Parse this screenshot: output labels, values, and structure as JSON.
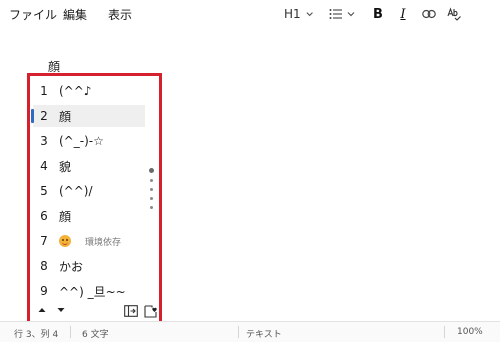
{
  "menu": {
    "file": "ファイル",
    "edit": "編集",
    "view": "表示"
  },
  "toolbar": {
    "heading": "H1",
    "icons": [
      "chevron-down-icon",
      "list-icon",
      "chevron-down-icon",
      "bold-icon",
      "italic-icon",
      "link-icon",
      "spellcheck-icon"
    ],
    "bold": "B",
    "italic": "I"
  },
  "editor": {
    "composing_text": "顔"
  },
  "ime": {
    "candidates": [
      {
        "num": "1",
        "text": "(^^♪"
      },
      {
        "num": "2",
        "text": "顔",
        "selected": true
      },
      {
        "num": "3",
        "text": "(^_-)-☆"
      },
      {
        "num": "4",
        "text": "貌"
      },
      {
        "num": "5",
        "text": "(^^)/"
      },
      {
        "num": "6",
        "text": "顔"
      },
      {
        "num": "7",
        "text": "",
        "emoji": "smiling-face-emoji",
        "note": "環境依存"
      },
      {
        "num": "8",
        "text": "かお"
      },
      {
        "num": "9",
        "text": "^^) _旦~~"
      }
    ],
    "footer_icons": [
      "arrow-up-icon",
      "arrow-down-icon",
      "expand-panel-icon",
      "favorite-icon"
    ]
  },
  "status": {
    "position": "行 3、列 4",
    "chars": "6 文字",
    "format": "テキスト",
    "zoom": "100%"
  },
  "colors": {
    "accent_red": "#d5212e",
    "selection_marker": "#2d6cc0"
  }
}
